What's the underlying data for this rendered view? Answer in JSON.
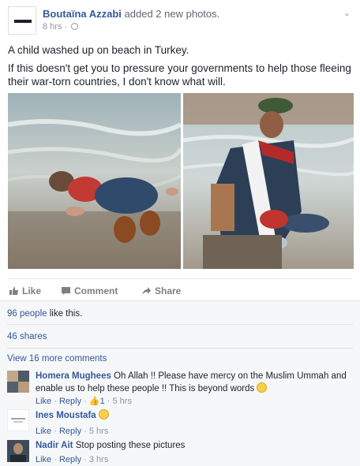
{
  "post": {
    "author": "Boutaïna Azzabi",
    "action": "added 2 new photos.",
    "time": "8 hrs",
    "text_line1": "A child washed up on beach in Turkey.",
    "text_line2": "If this doesn't get you to pressure your governments to help those fleeing their war-torn countries, I don't know what will."
  },
  "actions": {
    "like": "Like",
    "comment": "Comment",
    "share": "Share"
  },
  "stats": {
    "likes_link": "96 people",
    "likes_suffix": " like this.",
    "shares": "46 shares",
    "more_comments": "View 16 more comments"
  },
  "comments": [
    {
      "name": "Homera Mughees",
      "text": "Oh Allah !! Please have mercy on the Muslim Ummah and enable us to help these people !! This is beyond words",
      "like": "Like",
      "reply": "Reply",
      "reactions": "1",
      "time": "5 hrs"
    },
    {
      "name": "Ines Moustafa",
      "text": "",
      "like": "Like",
      "reply": "Reply",
      "time": "5 hrs"
    },
    {
      "name": "Nadir Ait",
      "text": "Stop posting these pictures",
      "like": "Like",
      "reply": "Reply",
      "time": "3 hrs"
    }
  ],
  "colors": {
    "link": "#365899",
    "muted": "#90949c",
    "feedback_bg": "#f6f7f9"
  }
}
